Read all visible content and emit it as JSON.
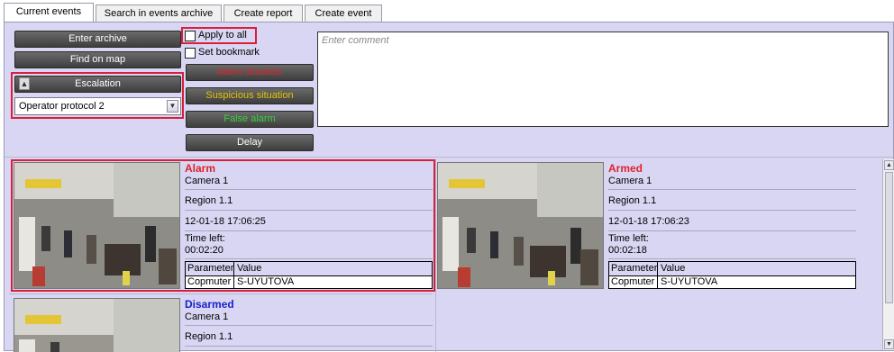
{
  "tabs": [
    {
      "label": "Current events",
      "active": true
    },
    {
      "label": "Search in events archive",
      "active": false
    },
    {
      "label": "Create report",
      "active": false
    },
    {
      "label": "Create event",
      "active": false
    }
  ],
  "controls": {
    "enter_archive": "Enter archive",
    "find_on_map": "Find on map",
    "escalation": "Escalation",
    "protocol_selected": "Operator protocol 2",
    "apply_to_all": "Apply to all",
    "set_bookmark": "Set bookmark",
    "alarm_situation": "Alarm situation",
    "suspicious_situation": "Suspicious situation",
    "false_alarm": "False alarm",
    "delay": "Delay",
    "comment_placeholder": "Enter comment"
  },
  "colors": {
    "panel_bg": "#d8d6f3",
    "highlight_red": "#d8203a",
    "alarm_text": "#e0232a",
    "suspicious_text": "#e5c400",
    "false_alarm_text": "#3bd13b",
    "disarmed_text": "#1a22c8"
  },
  "events": [
    {
      "status": "Alarm",
      "status_color": "#e0232a",
      "camera": "Camera 1",
      "region": "Region 1.1",
      "datetime": "12-01-18 17:06:25",
      "time_left_label": "Time left:",
      "time_left": "00:02:20",
      "param_header": "Parameter",
      "value_header": "Value",
      "param": "Copmuter",
      "value": "S-UYUTOVA"
    },
    {
      "status": "Armed",
      "status_color": "#e0232a",
      "camera": "Camera 1",
      "region": "Region 1.1",
      "datetime": "12-01-18 17:06:23",
      "time_left_label": "Time left:",
      "time_left": "00:02:18",
      "param_header": "Parameter",
      "value_header": "Value",
      "param": "Copmuter",
      "value": "S-UYUTOVA"
    },
    {
      "status": "Disarmed",
      "status_color": "#1a22c8",
      "camera": "Camera 1",
      "region": "Region 1.1"
    }
  ],
  "icons": {
    "collapse": "chevron-up-double-icon",
    "dropdown": "chevron-down-icon",
    "scroll_up": "scroll-up-icon",
    "scroll_down": "scroll-down-icon"
  }
}
